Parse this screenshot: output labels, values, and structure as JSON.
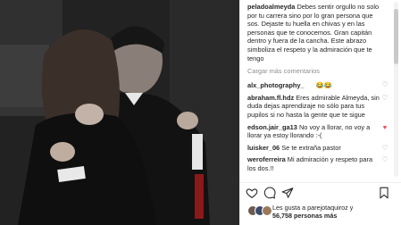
{
  "caption": {
    "username": "peladoalmeyda",
    "text": "Debes sentir orgullo no solo por tu carrera sino por lo gran persona que sos. Dejaste tu huella en chivas y en las personas que te conocemos. Gran capitán dentro y fuera de la cancha. Este abrazo simboliza el respeto y la admiración que te tengo"
  },
  "view_more": "Cargar más comentarios",
  "comments": [
    {
      "username": "alx_photography_",
      "text": "😂😂",
      "heart": "outline"
    },
    {
      "username": "abraham.fl.hdz",
      "text": "Eres admirable Almeyda, sin duda dejas aprendizaje no sólo para tus pupilos si no hasta la gente que te sigue",
      "heart": "outline"
    },
    {
      "username": "edson.jair_ga13",
      "text": "No voy a llorar, no voy a llorar ya estoy llorando :-(",
      "heart": "filled"
    },
    {
      "username": "luisker_06",
      "text": "Se te extraña pastor",
      "heart": "outline"
    },
    {
      "username": "weroferreira",
      "text": "Mi admiración y respeto para los dos.!!",
      "heart": "outline"
    }
  ],
  "likes": {
    "line1": "Les gusta a parejotaquiroz y",
    "line2": "56,758 personas más"
  },
  "colors": {
    "accent": "#ed4956",
    "muted": "#8e8e8e",
    "text": "#262626"
  },
  "icons": {
    "like": "heart-outline-icon",
    "comment": "speech-bubble-icon",
    "share": "paper-plane-icon",
    "save": "bookmark-icon"
  }
}
